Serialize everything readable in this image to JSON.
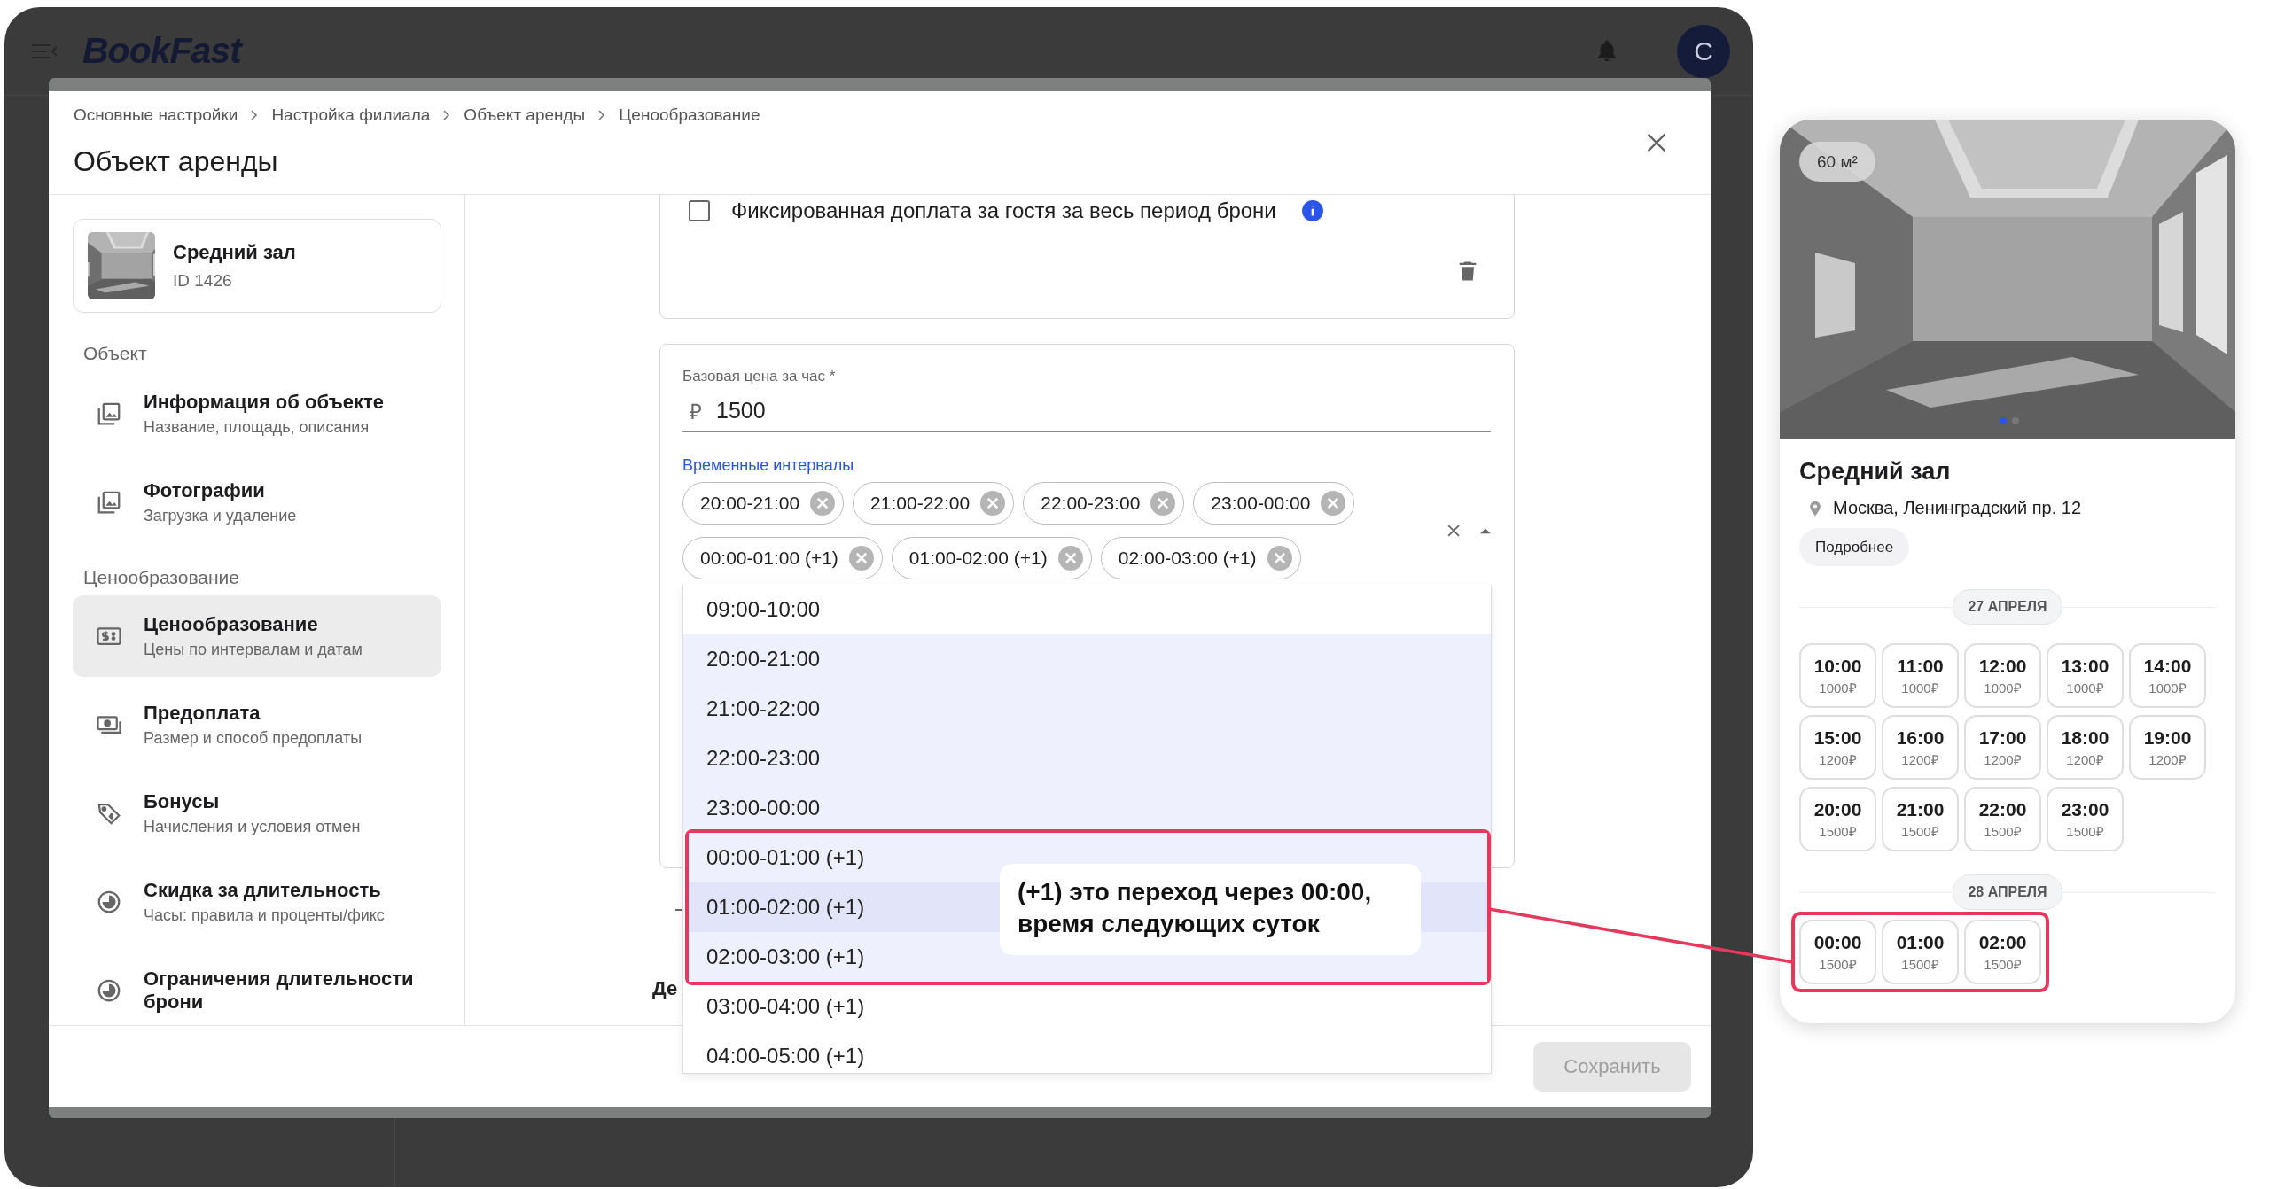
{
  "app": {
    "logo": "BookFast",
    "avatar": "C"
  },
  "modal": {
    "breadcrumbs": [
      "Основные настройки",
      "Настройка филиала",
      "Объект аренды",
      "Ценообразование"
    ],
    "title": "Объект аренды",
    "object_card": {
      "name": "Средний зал",
      "id": "ID 1426"
    },
    "nav_sections": [
      {
        "title": "Объект",
        "items": [
          {
            "kind": "photos",
            "title": "Информация об объекте",
            "subtitle": "Название, площадь, описания",
            "selected": false
          },
          {
            "kind": "photos",
            "title": "Фотографии",
            "subtitle": "Загрузка и удаление",
            "selected": false
          }
        ]
      },
      {
        "title": "Ценообразование",
        "items": [
          {
            "kind": "pricing",
            "title": "Ценообразование",
            "subtitle": "Цены по интервалам и датам",
            "selected": true
          },
          {
            "kind": "cash",
            "title": "Предоплата",
            "subtitle": "Размер и способ предоплаты",
            "selected": false
          },
          {
            "kind": "tag",
            "title": "Бонусы",
            "subtitle": "Начисления и условия отмен",
            "selected": false
          },
          {
            "kind": "pie",
            "title": "Скидка за длительность",
            "subtitle": "Часы: правила и проценты/фикс",
            "selected": false
          },
          {
            "kind": "pie",
            "title": "Ограничения длительности брони",
            "selected": false
          }
        ]
      }
    ],
    "surcharge_card": {
      "checkbox_label": "Фиксированная доплата за гостя за весь период брони",
      "checked": false
    },
    "price_card": {
      "price_label": "Базовая цена за час *",
      "currency": "₽",
      "price": "1500",
      "intervals_label": "Временные интервалы",
      "chips": [
        "20:00-21:00",
        "21:00-22:00",
        "22:00-23:00",
        "23:00-00:00",
        "00:00-01:00 (+1)",
        "01:00-02:00 (+1)",
        "02:00-03:00 (+1)"
      ]
    },
    "next_heading": "Де",
    "dropdown": [
      {
        "label": "09:00-10:00",
        "selected": false,
        "hovered": false,
        "annotated": false
      },
      {
        "label": "20:00-21:00",
        "selected": true,
        "hovered": false,
        "annotated": false
      },
      {
        "label": "21:00-22:00",
        "selected": true,
        "hovered": false,
        "annotated": false
      },
      {
        "label": "22:00-23:00",
        "selected": true,
        "hovered": false,
        "annotated": false
      },
      {
        "label": "23:00-00:00",
        "selected": true,
        "hovered": false,
        "annotated": false
      },
      {
        "label": "00:00-01:00 (+1)",
        "selected": true,
        "hovered": false,
        "annotated": true
      },
      {
        "label": "01:00-02:00 (+1)",
        "selected": true,
        "hovered": true,
        "annotated": true
      },
      {
        "label": "02:00-03:00 (+1)",
        "selected": true,
        "hovered": false,
        "annotated": true
      },
      {
        "label": "03:00-04:00 (+1)",
        "selected": false,
        "hovered": false,
        "annotated": false
      },
      {
        "label": "04:00-05:00 (+1)",
        "selected": false,
        "hovered": false,
        "annotated": false
      }
    ],
    "save_button": {
      "label": "Сохранить",
      "disabled": true
    }
  },
  "annotation": {
    "text": "(+1) это переход через 00:00,\nвремя следующих суток"
  },
  "preview": {
    "area": "60 м²",
    "title": "Средний зал",
    "address": "Москва, Ленинградский пр. 12",
    "details_button": "Подробнее",
    "days": [
      {
        "date": "27 АПРЕЛЯ",
        "annotated": false,
        "slots": [
          {
            "time": "10:00",
            "price": "1000₽"
          },
          {
            "time": "11:00",
            "price": "1000₽"
          },
          {
            "time": "12:00",
            "price": "1000₽"
          },
          {
            "time": "13:00",
            "price": "1000₽"
          },
          {
            "time": "14:00",
            "price": "1000₽"
          },
          {
            "time": "15:00",
            "price": "1200₽"
          },
          {
            "time": "16:00",
            "price": "1200₽"
          },
          {
            "time": "17:00",
            "price": "1200₽"
          },
          {
            "time": "18:00",
            "price": "1200₽"
          },
          {
            "time": "19:00",
            "price": "1200₽"
          },
          {
            "time": "20:00",
            "price": "1500₽"
          },
          {
            "time": "21:00",
            "price": "1500₽"
          },
          {
            "time": "22:00",
            "price": "1500₽"
          },
          {
            "time": "23:00",
            "price": "1500₽"
          }
        ]
      },
      {
        "date": "28 АПРЕЛЯ",
        "annotated": true,
        "slots": [
          {
            "time": "00:00",
            "price": "1500₽"
          },
          {
            "time": "01:00",
            "price": "1500₽"
          },
          {
            "time": "02:00",
            "price": "1500₽"
          }
        ]
      }
    ]
  }
}
